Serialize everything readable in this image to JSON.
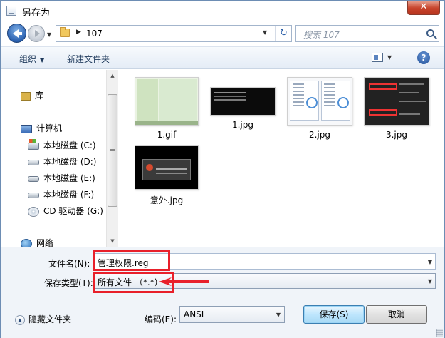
{
  "window": {
    "title": "另存为",
    "close_label": "✕"
  },
  "nav": {
    "breadcrumb": "107",
    "search_placeholder": "搜索 107",
    "refresh_glyph": "↻"
  },
  "toolbar": {
    "organize_label": "组织",
    "new_folder_label": "新建文件夹",
    "help_label": "?"
  },
  "sidebar": {
    "items": [
      {
        "label": "库",
        "icon": "library-icon"
      },
      {
        "label": "计算机",
        "icon": "computer-icon"
      },
      {
        "label": "本地磁盘 (C:)",
        "icon": "system-drive-icon"
      },
      {
        "label": "本地磁盘 (D:)",
        "icon": "drive-icon"
      },
      {
        "label": "本地磁盘 (E:)",
        "icon": "drive-icon"
      },
      {
        "label": "本地磁盘 (F:)",
        "icon": "drive-icon"
      },
      {
        "label": "CD 驱动器 (G:)",
        "icon": "cd-drive-icon"
      },
      {
        "label": "网络",
        "icon": "network-icon"
      }
    ]
  },
  "files": [
    {
      "name": "1.gif"
    },
    {
      "name": "1.jpg"
    },
    {
      "name": "2.jpg"
    },
    {
      "name": "3.jpg"
    },
    {
      "name": "意外.jpg"
    }
  ],
  "form": {
    "filename_label": "文件名(N):",
    "filename_value": "管理权限.reg",
    "filetype_label": "保存类型(T):",
    "filetype_value": "所有文件 （*.*）",
    "hide_folders_label": "隐藏文件夹",
    "encoding_label": "编码(E):",
    "encoding_value": "ANSI",
    "save_label": "保存(S)",
    "cancel_label": "取消"
  },
  "colors": {
    "annotation": "#e8202a",
    "accent": "#2b5fa8"
  }
}
